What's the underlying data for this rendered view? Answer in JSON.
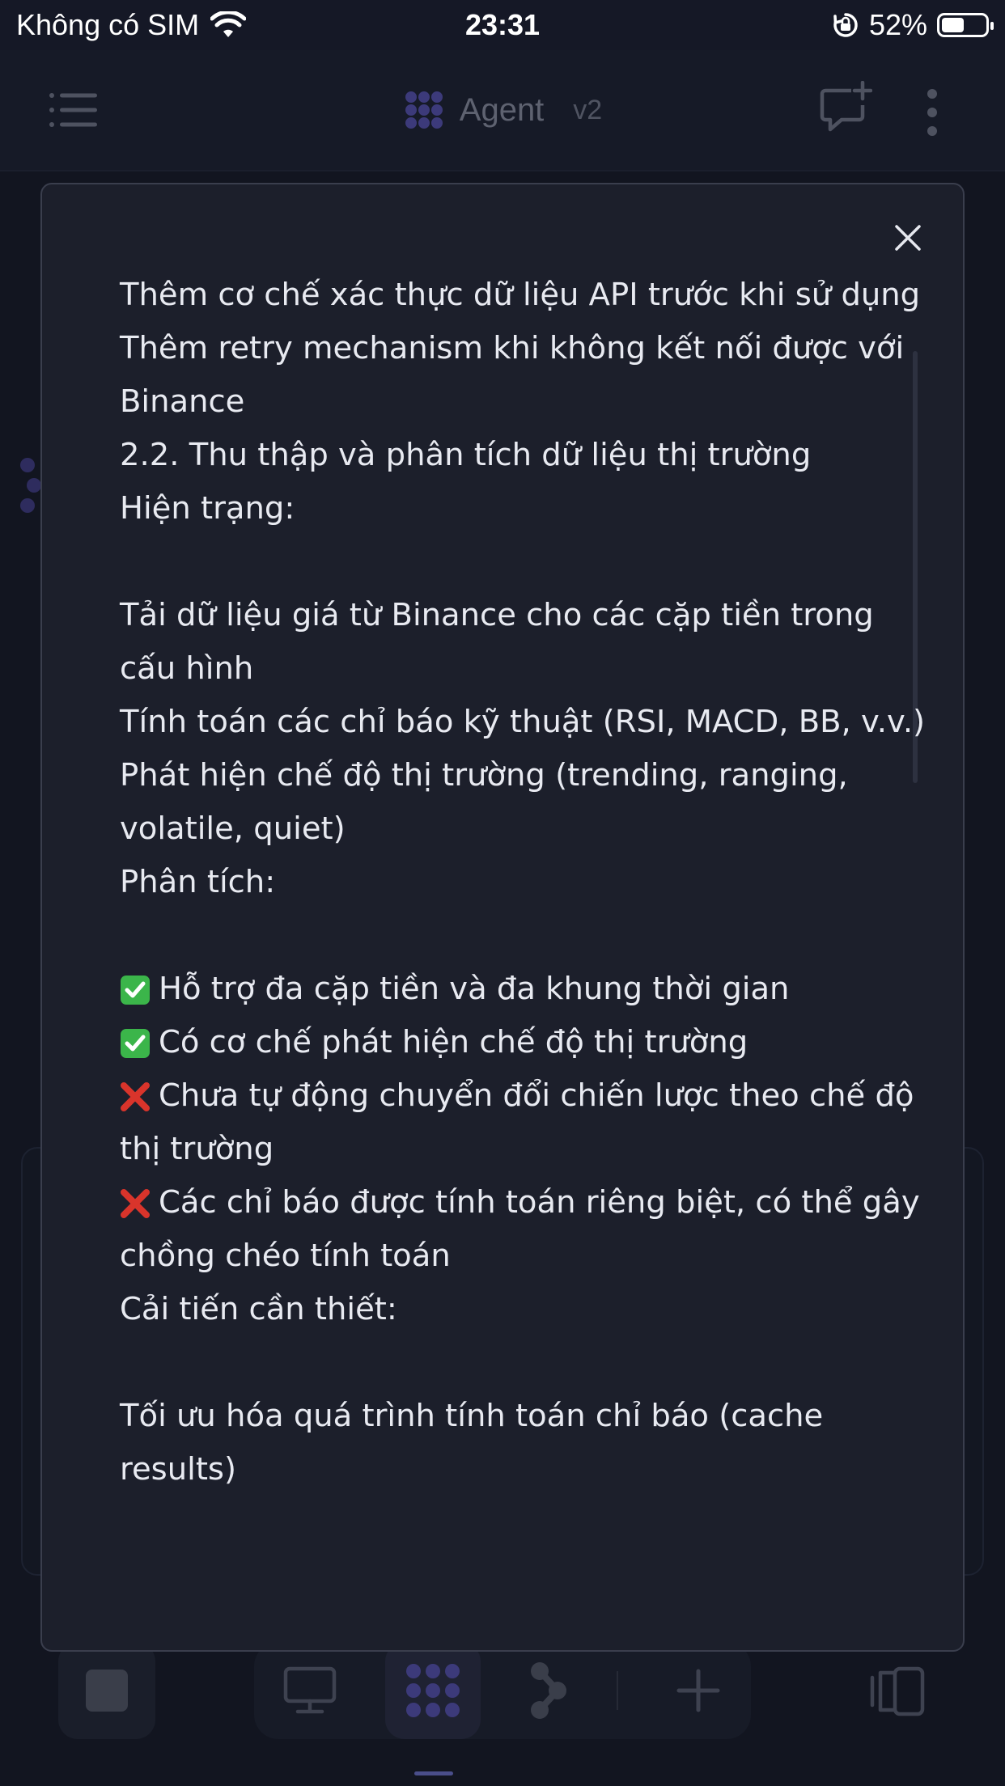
{
  "status_bar": {
    "carrier": "Không có SIM",
    "time": "23:31",
    "battery_percent": "52%",
    "battery_level": 0.52
  },
  "header": {
    "title": "Agent",
    "version": "v2",
    "icons": [
      "menu-icon",
      "agent-logo-icon",
      "new-chat-icon",
      "more-options-icon"
    ]
  },
  "modal": {
    "lines": [
      {
        "text": "Thêm cơ chế xác thực dữ liệu API trước khi sử dụng",
        "icon": null
      },
      {
        "text": "Thêm retry mechanism khi không kết nối được với Binance",
        "icon": null
      },
      {
        "text": "2.2. Thu thập và phân tích dữ liệu thị trường",
        "icon": null
      },
      {
        "text": "Hiện trạng:",
        "icon": null
      },
      {
        "text": "",
        "icon": null
      },
      {
        "text": "Tải dữ liệu giá từ Binance cho các cặp tiền trong cấu hình",
        "icon": null
      },
      {
        "text": "Tính toán các chỉ báo kỹ thuật (RSI, MACD, BB, v.v.)",
        "icon": null
      },
      {
        "text": "Phát hiện chế độ thị trường (trending, ranging, volatile, quiet)",
        "icon": null
      },
      {
        "text": "Phân tích:",
        "icon": null
      },
      {
        "text": "",
        "icon": null
      },
      {
        "text": "Hỗ trợ đa cặp tiền và đa khung thời gian",
        "icon": "check"
      },
      {
        "text": "Có cơ chế phát hiện chế độ thị trường",
        "icon": "check"
      },
      {
        "text": "Chưa tự động chuyển đổi chiến lược theo chế độ thị trường",
        "icon": "cross"
      },
      {
        "text": "Các chỉ báo được tính toán riêng biệt, có thể gây chồng chéo tính toán",
        "icon": "cross"
      },
      {
        "text": "Cải tiến cần thiết:",
        "icon": null
      },
      {
        "text": "",
        "icon": null
      },
      {
        "text": "Tối ưu hóa quá trình tính toán chỉ báo (cache results)",
        "icon": null
      }
    ]
  },
  "bottom_bar": {
    "icons": [
      "stop-icon",
      "desktop-icon",
      "agent-icon",
      "workflow-icon",
      "add-icon",
      "panel-toggle-icon"
    ]
  },
  "colors": {
    "background": "#121520",
    "modal_background": "#1c1f2b",
    "accent": "#5b52c9",
    "check_green": "#3bb54a",
    "cross_red": "#d9342b"
  }
}
